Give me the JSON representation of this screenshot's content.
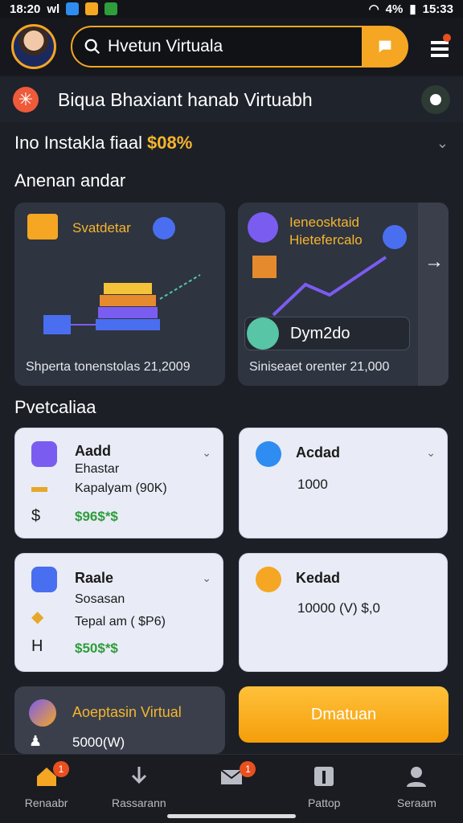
{
  "status_bar": {
    "time_left": "18:20",
    "carrier": "wl",
    "battery": "4%",
    "time_right": "15:33"
  },
  "header": {
    "search_text": "Hvetun Virtuala"
  },
  "banner": {
    "text": "Biqua Bhaxiant hanab Virtuabh"
  },
  "info": {
    "label": "Ino Instakla fiaal",
    "value": "$08%"
  },
  "sections": {
    "featured_title": "Anenan andar",
    "portfolio_title": "Pvetcaliaa"
  },
  "featured": [
    {
      "title": "Svatdetar",
      "footer": "Shperta tonenstolas 21,2009"
    },
    {
      "title": "Ieneosktaid Hietefercalo",
      "footer": "Siniseaet orenter 21,000",
      "pill": "Dym2do"
    }
  ],
  "assets": [
    {
      "title": "Aadd",
      "line1": "Ehastar",
      "line2": "Kapalyam (90K)",
      "line3": "$96$*$",
      "color": "#7b5cf0"
    },
    {
      "title": "Acdad",
      "line1": "1000",
      "color": "#2f8cf0"
    },
    {
      "title": "Raale",
      "line1": "Sosasan",
      "line2": "Tepal am ( $P6)",
      "line3": "$50$*$",
      "color": "#4a6ef0"
    },
    {
      "title": "Kedad",
      "line1": "10000 (V) $,0",
      "color": "#f5a623"
    }
  ],
  "bottom_cards": {
    "dark_title": "Aoeptasin Virtual",
    "dark_value": "5000(W)",
    "button_label": "Dmatuan"
  },
  "nav": [
    {
      "label": "Renaabr",
      "badge": "1"
    },
    {
      "label": "Rassarann"
    },
    {
      "label": "",
      "badge": "1"
    },
    {
      "label": "Pattop"
    },
    {
      "label": "Seraam"
    }
  ],
  "colors": {
    "accent": "#f5a623",
    "background": "#1c1f26",
    "card_light": "#e9ecf6",
    "positive": "#2e9d3a"
  }
}
